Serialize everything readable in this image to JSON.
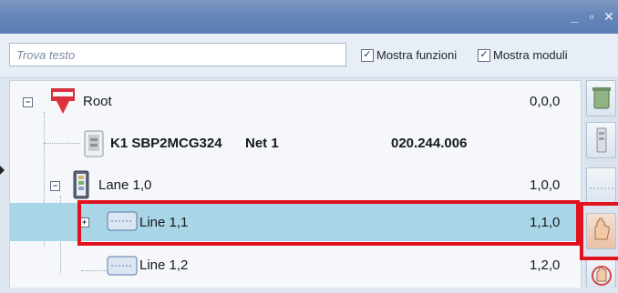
{
  "search": {
    "placeholder": "Trova testo"
  },
  "options": {
    "show_functions_label": "Mostra funzioni",
    "show_modules_label": "Mostra moduli"
  },
  "colors": {
    "selection": "#a8d6e6",
    "highlight_border": "#e0121d",
    "titlebar": "#6686b9"
  },
  "tree": {
    "root": {
      "label": "Root",
      "address": "0,0,0",
      "icon": "root-network-icon"
    },
    "module": {
      "name": "K1 SBP2MCG324",
      "net": "Net 1",
      "address": "020.244.006",
      "icon": "module-device-icon"
    },
    "lane": {
      "label": "Lane 1,0",
      "address": "1,0,0",
      "icon": "lane-icon"
    },
    "line1": {
      "label": "Line 1,1",
      "address": "1,1,0",
      "icon": "line-icon",
      "selected": true
    },
    "line2": {
      "label": "Line 1,2",
      "address": "1,2,0",
      "icon": "line-icon"
    }
  },
  "rail": {
    "buttons": [
      "trash-icon",
      "device-icon",
      "line-icon",
      "hand-icon",
      "hand-refresh-icon"
    ]
  }
}
